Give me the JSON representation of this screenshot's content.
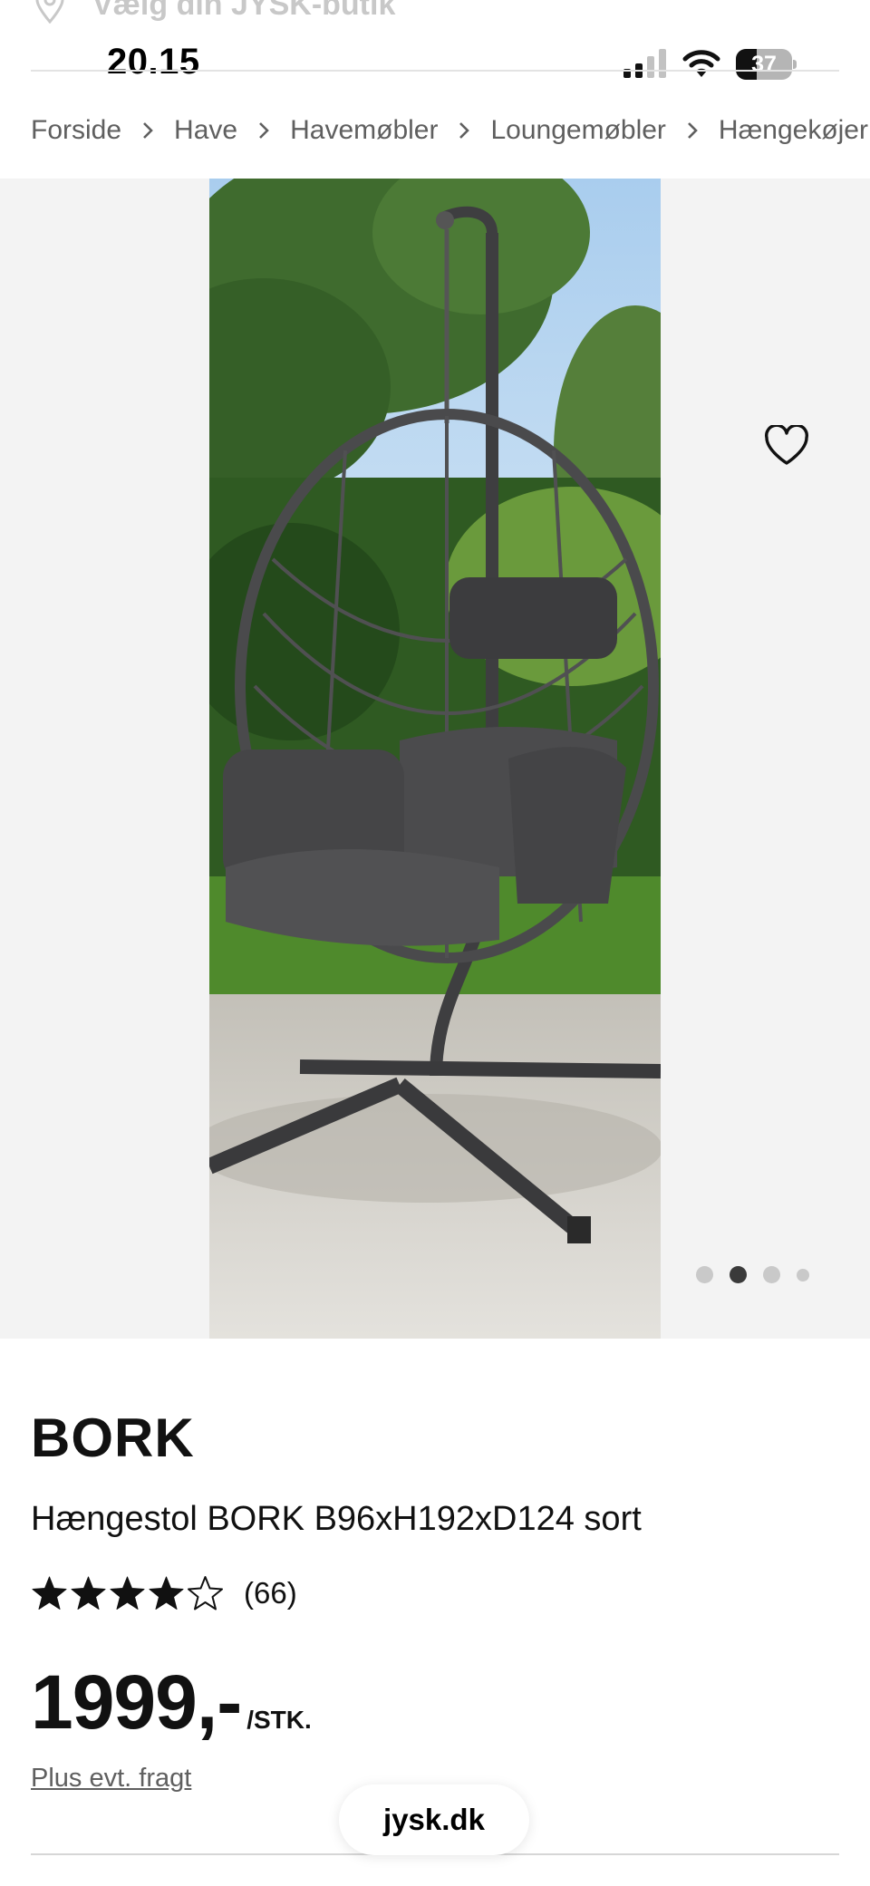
{
  "store": {
    "label": "Vælg din JYSK-butik"
  },
  "status_bar": {
    "time": "20.15",
    "battery": "37",
    "battery_level": 0.37
  },
  "breadcrumb": [
    {
      "label": "Forside"
    },
    {
      "label": "Have"
    },
    {
      "label": "Havemøbler"
    },
    {
      "label": "Loungemøbler"
    },
    {
      "label": "Hængekøjer"
    }
  ],
  "gallery": {
    "image_count": 4,
    "active_index": 1
  },
  "product": {
    "brand": "BORK",
    "name": "Hængestol BORK B96xH192xD124 sort",
    "rating": 4,
    "rating_max": 5,
    "review_count": "(66)",
    "price": "1999,-",
    "price_unit": "/STK.",
    "shipping_note": "Plus evt. fragt"
  },
  "browser": {
    "url": "jysk.dk"
  },
  "icons": {
    "location": "location-pin-icon",
    "favorite": "heart-outline-icon",
    "breadcrumb_separator": "chevron-right-icon",
    "star_filled": "star-filled-icon",
    "star_empty": "star-outline-icon"
  }
}
